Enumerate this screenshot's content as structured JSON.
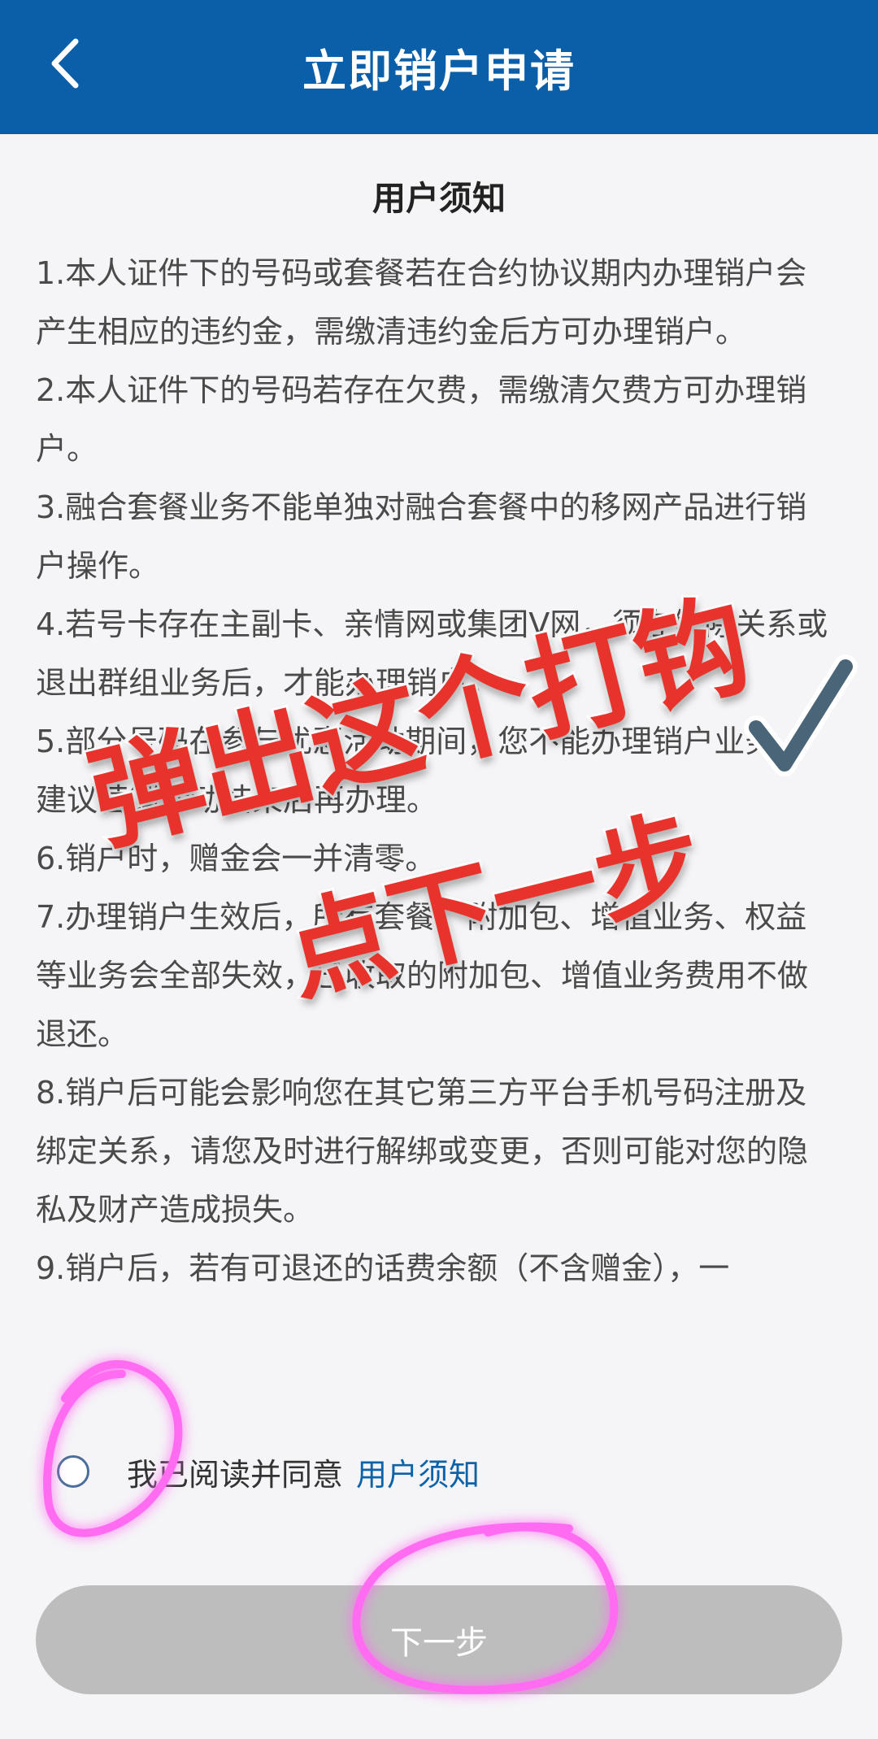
{
  "header": {
    "title": "立即销户申请",
    "back_icon": "chevron-left-icon",
    "background": "#0b5fa8"
  },
  "notice": {
    "title": "用户须知",
    "items": [
      "1.本人证件下的号码或套餐若在合约协议期内办理销户会产生相应的违约金，需缴清违约金后方可办理销户。",
      "2.本人证件下的号码若存在欠费，需缴清欠费方可办理销户。",
      "3.融合套餐业务不能单独对融合套餐中的移网产品进行销户操作。",
      "4.若号卡存在主副卡、亲情网或集团V网，须在解除关系或退出群组业务后，才能办理销户。",
      "5.部分号码在参与优惠活动期间，您不能办理销户业务，建议营销活动结束后再办理。",
      "6.销户时，赠金会一并清零。",
      "7.办理销户生效后，所有套餐、附加包、增值业务、权益等业务会全部失效，已收取的附加包、增值业务费用不做退还。",
      "8.销户后可能会影响您在其它第三方平台手机号码注册及绑定关系，请您及时进行解绑或变更，否则可能对您的隐私及财产造成损失。",
      "9.销户后，若有可退还的话费余额（不含赠金），一"
    ]
  },
  "agreement": {
    "text": "我已阅读并同意",
    "link": "用户须知",
    "checked": false
  },
  "next_button": {
    "label": "下一步",
    "enabled": false
  },
  "overlay": {
    "line1": "弹出这个打钩",
    "line2": "点下一步",
    "text_color": "#e8322c",
    "highlight_color": "#ff4df0"
  }
}
